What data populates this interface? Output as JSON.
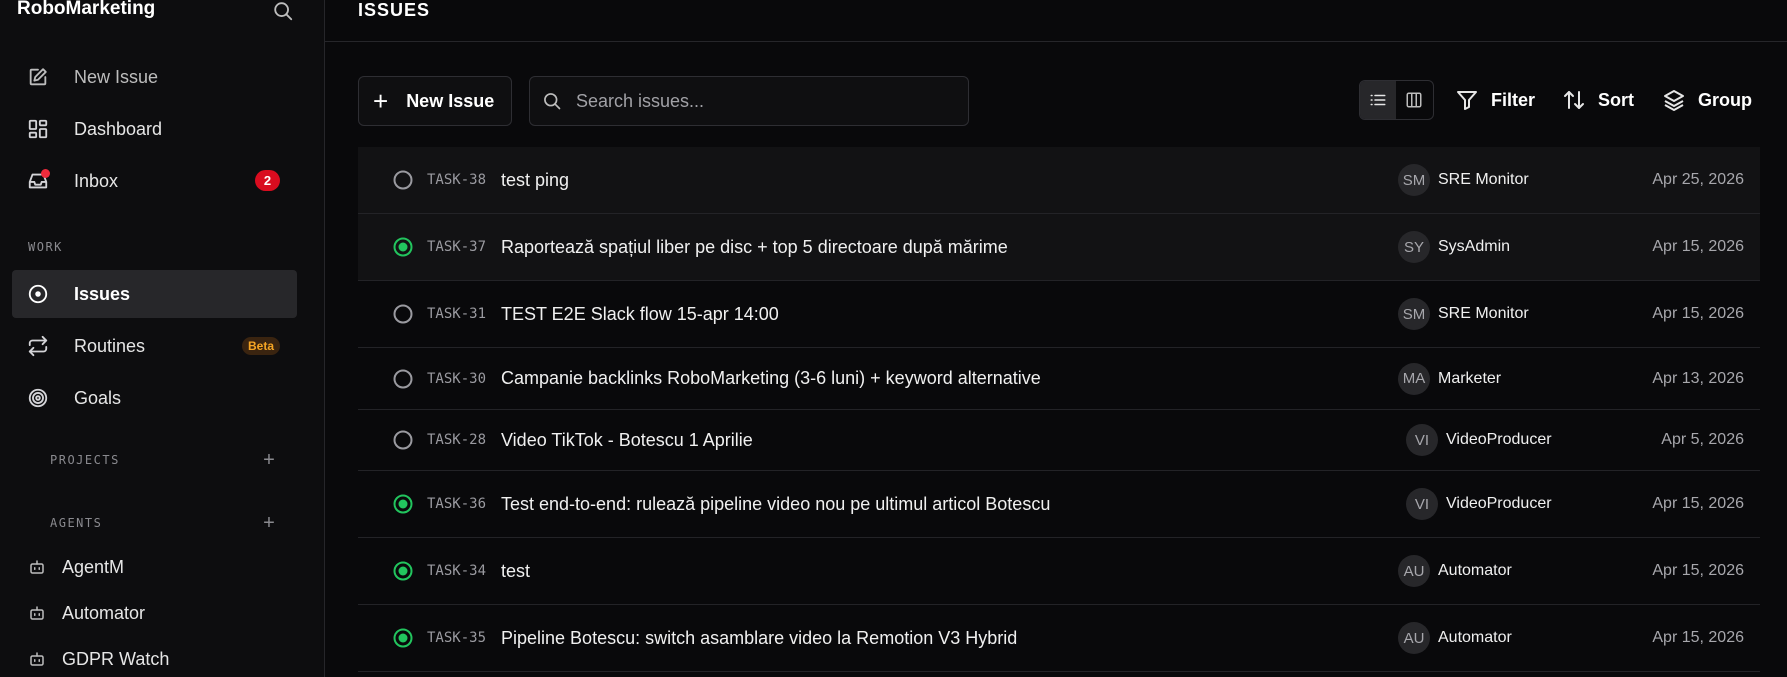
{
  "app": {
    "title": "RoboMarketing"
  },
  "sidebar": {
    "new_issue": "New Issue",
    "dashboard": "Dashboard",
    "inbox": {
      "label": "Inbox",
      "count": "2"
    },
    "work_label": "WORK",
    "issues": "Issues",
    "routines": {
      "label": "Routines",
      "badge": "Beta"
    },
    "goals": "Goals",
    "projects_label": "PROJECTS",
    "agents_label": "AGENTS",
    "agents": [
      "AgentM",
      "Automator",
      "GDPR Watch"
    ]
  },
  "header": {
    "title": "ISSUES"
  },
  "toolbar": {
    "new_issue": "New Issue",
    "search_placeholder": "Search issues...",
    "filter": "Filter",
    "sort": "Sort",
    "group": "Group",
    "view_mode": "list"
  },
  "colors": {
    "done": "#22c55e",
    "open": "#9a9aa0",
    "badge": "#d90c1f",
    "beta": "#f5a524"
  },
  "issues": [
    {
      "id": "TASK-38",
      "title": "test ping",
      "status": "open",
      "initials": "SM",
      "assignee": "SRE Monitor",
      "date": "Apr 25, 2026"
    },
    {
      "id": "TASK-37",
      "title": "Raportează spațiul liber pe disc + top 5 directoare după mărime",
      "status": "done",
      "initials": "SY",
      "assignee": "SysAdmin",
      "date": "Apr 15, 2026"
    },
    {
      "id": "TASK-31",
      "title": "TEST E2E Slack flow 15-apr 14:00",
      "status": "open",
      "initials": "SM",
      "assignee": "SRE Monitor",
      "date": "Apr 15, 2026"
    },
    {
      "id": "TASK-30",
      "title": "Campanie backlinks RoboMarketing (3-6 luni) + keyword alternative",
      "status": "open",
      "initials": "MA",
      "assignee": "Marketer",
      "date": "Apr 13, 2026"
    },
    {
      "id": "TASK-28",
      "title": "Video TikTok - Botescu 1 Aprilie",
      "status": "open",
      "initials": "VI",
      "assignee": "VideoProducer",
      "date": "Apr 5, 2026"
    },
    {
      "id": "TASK-36",
      "title": "Test end-to-end: rulează pipeline video nou pe ultimul articol Botescu",
      "status": "done",
      "initials": "VI",
      "assignee": "VideoProducer",
      "date": "Apr 15, 2026"
    },
    {
      "id": "TASK-34",
      "title": "test",
      "status": "done",
      "initials": "AU",
      "assignee": "Automator",
      "date": "Apr 15, 2026"
    },
    {
      "id": "TASK-35",
      "title": "Pipeline Botescu: switch asamblare video la Remotion V3 Hybrid",
      "status": "done",
      "initials": "AU",
      "assignee": "Automator",
      "date": "Apr 15, 2026"
    }
  ]
}
